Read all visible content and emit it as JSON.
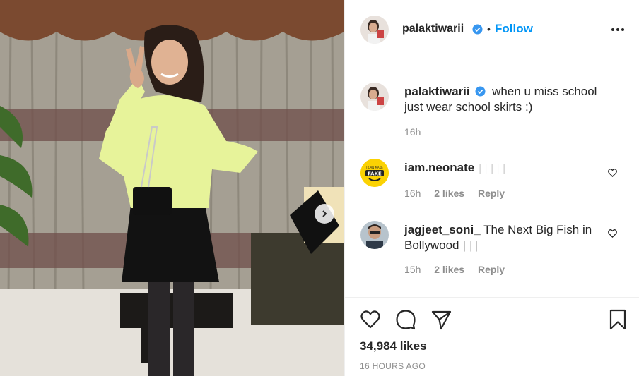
{
  "post": {
    "header": {
      "username": "palaktiwarii",
      "separator": "•",
      "follow_label": "Follow",
      "more_icon": "more-horizontal-icon"
    },
    "caption": {
      "username": "palaktiwarii",
      "text": "when u miss school just wear school skirts :)",
      "time": "16h"
    },
    "comments": [
      {
        "username": "iam.neonate",
        "text": "",
        "avatar_text": [
          "I CAN MAKE",
          "FAKE"
        ],
        "time": "16h",
        "likes": "2 likes",
        "reply_label": "Reply"
      },
      {
        "username": "jagjeet_soni_",
        "text": "The Next Big Fish in Bollywood",
        "time": "15h",
        "likes": "2 likes",
        "reply_label": "Reply"
      }
    ],
    "likes_count": "34,984 likes",
    "timestamp": "16 HOURS AGO",
    "icons": {
      "like": "heart-icon",
      "comment": "comment-icon",
      "share": "send-icon",
      "save": "bookmark-icon",
      "next": "chevron-right-icon",
      "verified": "verified-badge-icon"
    },
    "colors": {
      "follow": "#0095f6",
      "verified": "#3897f0",
      "muted": "#8e8e8e",
      "text": "#262626"
    }
  }
}
